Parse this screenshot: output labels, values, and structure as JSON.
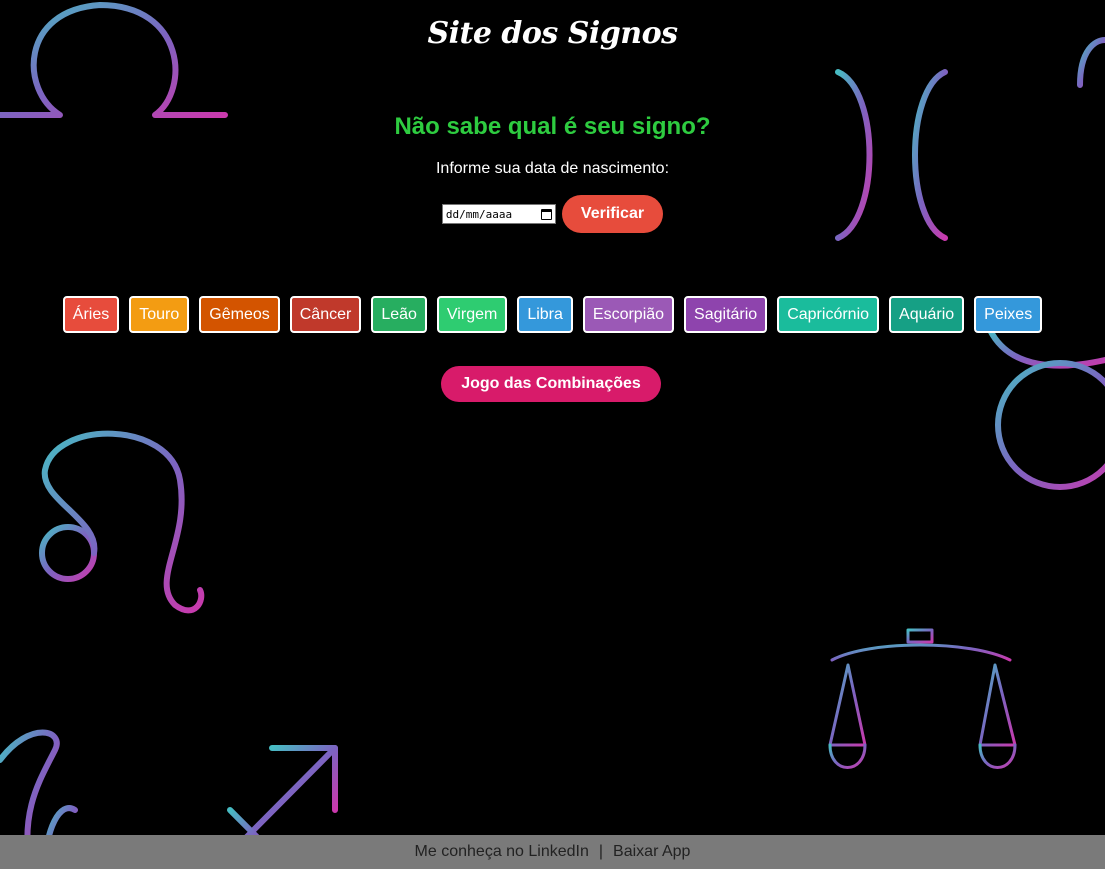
{
  "header": {
    "title": "Site dos Signos"
  },
  "finder": {
    "question": "Não sabe qual é seu signo?",
    "instruction": "Informe sua data de nascimento:",
    "date_placeholder": "dd/mm/aaaa",
    "verify_label": "Verificar"
  },
  "signs": [
    {
      "label": "Áries",
      "color": "#e74c3c"
    },
    {
      "label": "Touro",
      "color": "#f39c12"
    },
    {
      "label": "Gêmeos",
      "color": "#d35400"
    },
    {
      "label": "Câncer",
      "color": "#c0392b"
    },
    {
      "label": "Leão",
      "color": "#27ae60"
    },
    {
      "label": "Virgem",
      "color": "#2ecc71"
    },
    {
      "label": "Libra",
      "color": "#3498db"
    },
    {
      "label": "Escorpião",
      "color": "#9b59b6"
    },
    {
      "label": "Sagitário",
      "color": "#8e44ad"
    },
    {
      "label": "Capricórnio",
      "color": "#1abc9c"
    },
    {
      "label": "Aquário",
      "color": "#16a085"
    },
    {
      "label": "Peixes",
      "color": "#3498db"
    }
  ],
  "combo": {
    "label": "Jogo das Combinações",
    "color": "#d81b6a"
  },
  "footer": {
    "linkedin_label": "Me conheça no LinkedIn",
    "separator": "|",
    "app_label": "Baixar App"
  },
  "background": {
    "icons": [
      "libra-symbol-icon",
      "pisces-symbol-icon",
      "taurus-symbol-icon",
      "leo-symbol-icon",
      "scales-icon",
      "sagittarius-symbol-icon",
      "capricorn-symbol-icon"
    ]
  }
}
